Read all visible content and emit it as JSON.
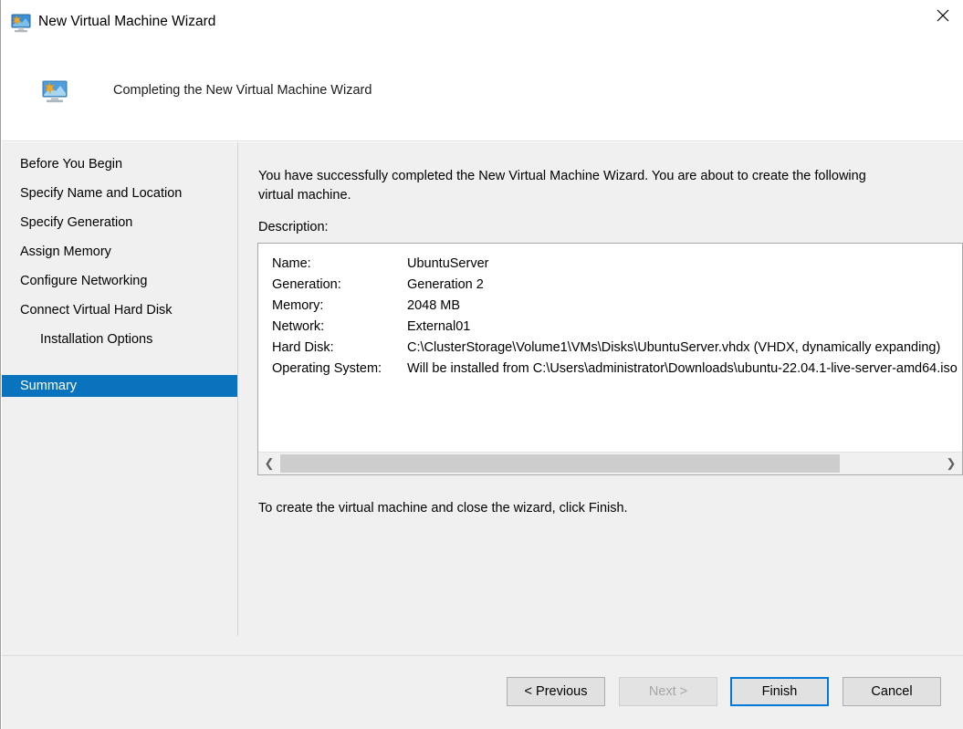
{
  "window": {
    "title": "New Virtual Machine Wizard",
    "title_icon": "virtual-machine-monitor-icon",
    "close_icon": "close-icon"
  },
  "header": {
    "title": "Completing the New Virtual Machine Wizard",
    "icon": "virtual-machine-monitor-icon"
  },
  "sidebar": {
    "selected": "Summary",
    "selected_color": "#0a73bd",
    "items": [
      {
        "label": "Before You Begin",
        "indented": false,
        "selected": false
      },
      {
        "label": "Specify Name and Location",
        "indented": false,
        "selected": false
      },
      {
        "label": "Specify Generation",
        "indented": false,
        "selected": false
      },
      {
        "label": "Assign Memory",
        "indented": false,
        "selected": false
      },
      {
        "label": "Configure Networking",
        "indented": false,
        "selected": false
      },
      {
        "label": "Connect Virtual Hard Disk",
        "indented": false,
        "selected": false
      },
      {
        "label": "Installation Options",
        "indented": true,
        "selected": false
      },
      {
        "label": "Summary",
        "indented": false,
        "selected": true
      }
    ]
  },
  "content": {
    "intro_text": "You have successfully completed the New Virtual Machine Wizard. You are about to create the following virtual machine.",
    "description_label": "Description:",
    "finish_hint": "To create the virtual machine and close the wizard, click Finish.",
    "spec_rows": [
      {
        "key": "Name:",
        "value": "UbuntuServer"
      },
      {
        "key": "Generation:",
        "value": "Generation 2"
      },
      {
        "key": "Memory:",
        "value": "2048 MB"
      },
      {
        "key": "Network:",
        "value": "External01"
      },
      {
        "key": "Hard Disk:",
        "value": "C:\\ClusterStorage\\Volume1\\VMs\\Disks\\UbuntuServer.vhdx (VHDX, dynamically expanding)"
      },
      {
        "key": "Operating System:",
        "value": "Will be installed from C:\\Users\\administrator\\Downloads\\ubuntu-22.04.1-live-server-amd64.iso"
      }
    ],
    "scrollbar": {
      "left_arrow_icon": "chevron-left-icon",
      "right_arrow_icon": "chevron-right-icon"
    }
  },
  "footer": {
    "buttons": [
      {
        "label": "< Previous",
        "state": "enabled"
      },
      {
        "label": "Next >",
        "state": "disabled"
      },
      {
        "label": "Finish",
        "state": "default"
      },
      {
        "label": "Cancel",
        "state": "enabled"
      }
    ],
    "focus_color": "#0078d7"
  }
}
